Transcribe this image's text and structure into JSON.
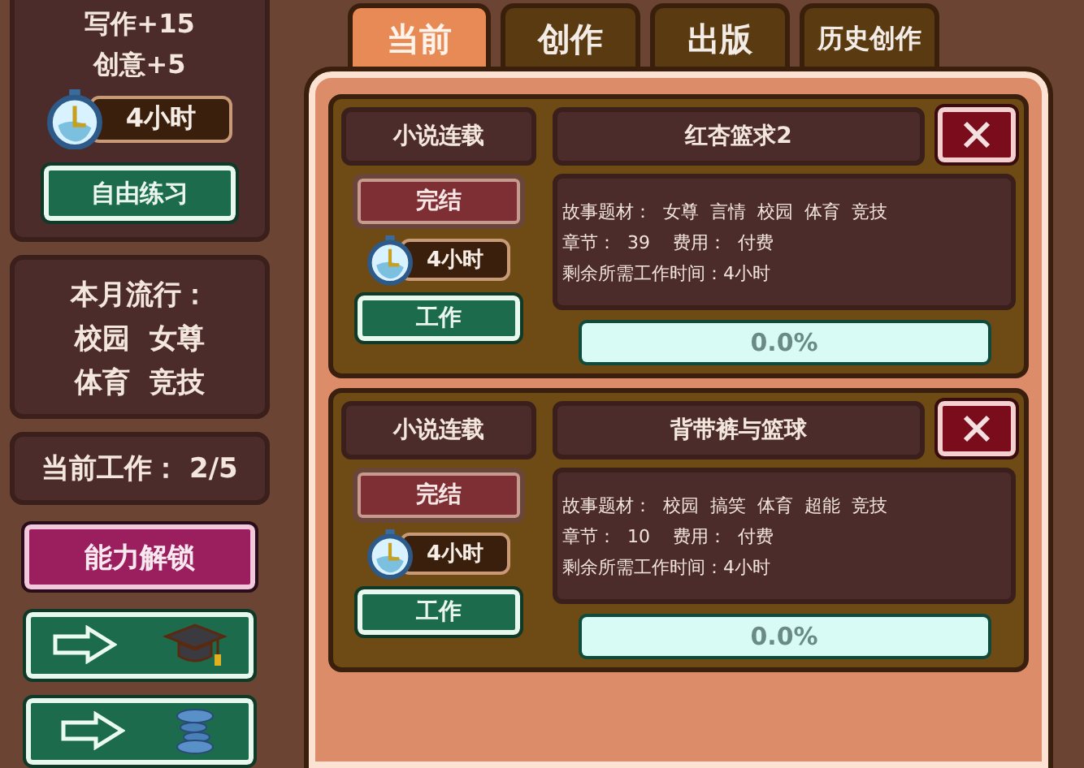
{
  "sidebar": {
    "practice": {
      "gains": [
        "写作+15",
        "创意+5"
      ],
      "time": "4小时",
      "button": "自由练习"
    },
    "trend": {
      "title": "本月流行：",
      "lines": [
        "校园  女尊",
        "体育  竞技"
      ]
    },
    "workload": "当前工作： 2/5",
    "unlock_button": "能力解锁",
    "nav_buttons": [
      {
        "kind": "graduation"
      },
      {
        "kind": "spring"
      }
    ]
  },
  "tabs": [
    {
      "label": "当前",
      "selected": true
    },
    {
      "label": "创作",
      "selected": false
    },
    {
      "label": "出版",
      "selected": false
    },
    {
      "label": "历史创作",
      "selected": false
    }
  ],
  "works": [
    {
      "type": "小说连载",
      "title": "红杏篮求2",
      "finish_button": "完结",
      "time": "4小时",
      "work_button": "工作",
      "info": [
        "故事题材：  女尊  言情  校园  体育  竞技",
        "章节：  39    费用：  付费",
        "剩余所需工作时间：4小时"
      ],
      "progress": "0.0%",
      "level": 0
    },
    {
      "type": "小说连载",
      "title": "背带裤与篮球",
      "finish_button": "完结",
      "time": "4小时",
      "work_button": "工作",
      "info": [
        "故事题材：  校园  搞笑  体育  超能  竞技",
        "章节：  10    费用：  付费",
        "剩余所需工作时间：4小时"
      ],
      "progress": "0.0%",
      "level": 0
    }
  ]
}
